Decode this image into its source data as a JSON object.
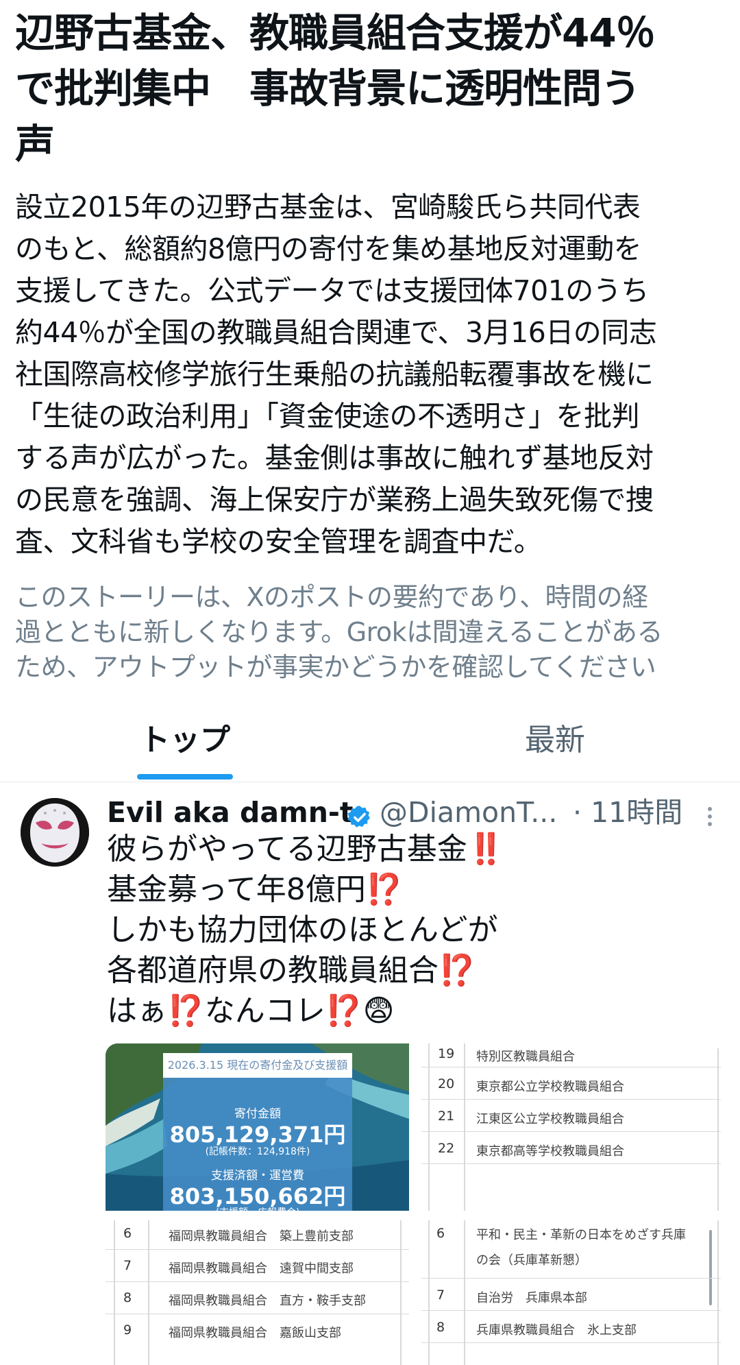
{
  "headline": {
    "lines": [
      "辺野古基金、教職員組合支援が44％",
      "で批判集中　事故背景に透明性問う",
      "声"
    ]
  },
  "summary": {
    "lines": [
      "設立2015年の辺野古基金は、宮崎駿氏ら共同代表",
      "のもと、総額約8億円の寄付を集め基地反対運動を",
      "支援してきた。公式データでは支援団体701のうち",
      "約44％が全国の教職員組合関連で、3月16日の同志",
      "社国際高校修学旅行生乗船の抗議船転覆事故を機に",
      "「生徒の政治利用」「資金使途の不透明さ」を批判",
      "する声が広がった。基金側は事故に触れず基地反対",
      "の民意を強調、海上保安庁が業務上過失致死傷で捜",
      "査、文科省も学校の安全管理を調査中だ。"
    ]
  },
  "disclaimer": {
    "lines": [
      "このストーリーは、Xのポストの要約であり、時間の経",
      "過とともに新しくなります。Grokは間違えることがある",
      "ため、アウトプットが事実かどうかを確認してください"
    ]
  },
  "tabs": {
    "top": "トップ",
    "latest": "最新",
    "accent": "#1d9bf0"
  },
  "post": {
    "display_name": "Evil aka damn-t",
    "handle": "@DiamonT...",
    "time": "· 11時間",
    "lines": [
      "彼らがやってる辺野古基金‼️",
      "基金募って年8億円⁉️",
      "しかも協力団体のほとんどが",
      "各都道府県の教職員組合⁉️",
      "はぁ⁉️なんコレ⁉️😨"
    ],
    "media": {
      "stats": {
        "date_caption": "2026.3.15 現在の寄付金及び支援額",
        "donation_label": "寄付金額",
        "donation_amount": "805,129,371円",
        "donation_note": "(記帳件数：124,918件)",
        "support_label": "支援済額・運営費",
        "support_amount": "803,150,662円",
        "support_note": "(支援額・広報費合)"
      },
      "table_tr": [
        {
          "num": "19",
          "org": "特別区教職員組合"
        },
        {
          "num": "20",
          "org": "東京都公立学校教職員組合"
        },
        {
          "num": "21",
          "org": "江東区公立学校教職員組合"
        },
        {
          "num": "22",
          "org": "東京都高等学校教職員組合"
        }
      ],
      "table_bl": [
        {
          "num": "6",
          "org": "福岡県教職員組合　築上豊前支部"
        },
        {
          "num": "7",
          "org": "福岡県教職員組合　遠賀中間支部"
        },
        {
          "num": "8",
          "org": "福岡県教職員組合　直方・鞍手支部"
        },
        {
          "num": "9",
          "org": "福岡県教職員組合　嘉飯山支部"
        }
      ],
      "table_br": [
        {
          "num": "6",
          "org": "平和・民主・革新の日本をめざす兵庫",
          "org2": "の会（兵庫革新懇）"
        },
        {
          "num": "7",
          "org": "自治労　兵庫県本部"
        },
        {
          "num": "8",
          "org": "兵庫県教職員組合　氷上支部"
        }
      ]
    }
  }
}
